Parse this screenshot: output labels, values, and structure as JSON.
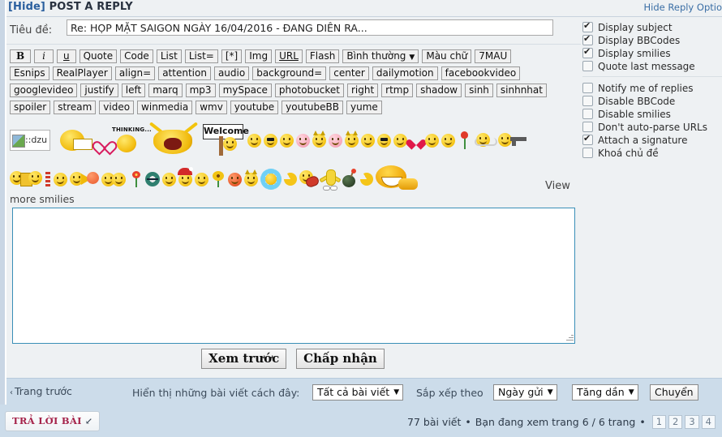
{
  "header": {
    "hide_label": "[Hide]",
    "title": "POST A REPLY",
    "hide_reply_options": "Hide Reply Optio"
  },
  "subject": {
    "label": "Tiêu đề:",
    "value": "Re: HỌP MẶT SAIGON NGÀY 16/04/2016 - ĐANG DIỄN RA...",
    "placeholder": ""
  },
  "bbcode_toolbar": {
    "rows": [
      [
        "B",
        "i",
        "u",
        "Quote",
        "Code",
        "List",
        "List=",
        "[*]",
        "Img",
        "URL",
        "Flash"
      ],
      [
        "Esnips",
        "RealPlayer",
        "align=",
        "attention",
        "audio",
        "background=",
        "center",
        "dailymotion",
        "facebookvideo"
      ],
      [
        "googlevideo",
        "justify",
        "left",
        "marq",
        "mp3",
        "mySpace",
        "photobucket",
        "right",
        "rtmp",
        "shadow",
        "sinh",
        "sinhnhat"
      ],
      [
        "spoiler",
        "stream",
        "video",
        "winmedia",
        "wmv",
        "youtube",
        "youtubeBB",
        "yume"
      ]
    ],
    "font_size_select": "Bình thường",
    "font_color_button": "Màu chữ",
    "rainbow_button": "7MAU"
  },
  "reply_options": {
    "group1": [
      {
        "label": "Display subject",
        "checked": true
      },
      {
        "label": "Display BBCodes",
        "checked": true
      },
      {
        "label": "Display smilies",
        "checked": true
      },
      {
        "label": "Quote last message",
        "checked": false
      }
    ],
    "group2": [
      {
        "label": "Notify me of replies",
        "checked": false
      },
      {
        "label": "Disable BBCode",
        "checked": false
      },
      {
        "label": "Disable smilies",
        "checked": false
      },
      {
        "label": "Don't auto-parse URLs",
        "checked": false
      },
      {
        "label": "Attach a signature",
        "checked": true
      },
      {
        "label": "Khoá chủ đề",
        "checked": false
      }
    ]
  },
  "smilies": {
    "broken_image_alt": "::dzu",
    "welcome_sign_text": "Welcome",
    "thinking_text": "THINKING...",
    "view_label": "View",
    "more_smilies_label": "more smilies"
  },
  "message": {
    "value": "",
    "placeholder": ""
  },
  "actions": {
    "preview": "Xem trước",
    "submit": "Chấp nhận"
  },
  "bottom_bar": {
    "prev_page": "Trang trước",
    "display_label": "Hiển thị những bài viết cách đây:",
    "display_select": "Tất cả bài viết",
    "sort_label": "Sắp xếp theo",
    "sort_select": "Ngày gửi",
    "order_select": "Tăng dần",
    "go_button": "Chuyển"
  },
  "footer": {
    "reply_button": "TRẢ LỜI BÀI",
    "post_count": "77 bài viết",
    "page_info": "Bạn đang xem trang 6 / 6 trang",
    "pages": [
      "1",
      "2",
      "3",
      "4"
    ]
  },
  "colors": {
    "accent_blue": "#3a6ea5",
    "bar_blue": "#ccdcea",
    "reply_crimson": "#a5234a",
    "textarea_border": "#3a8fb7"
  }
}
